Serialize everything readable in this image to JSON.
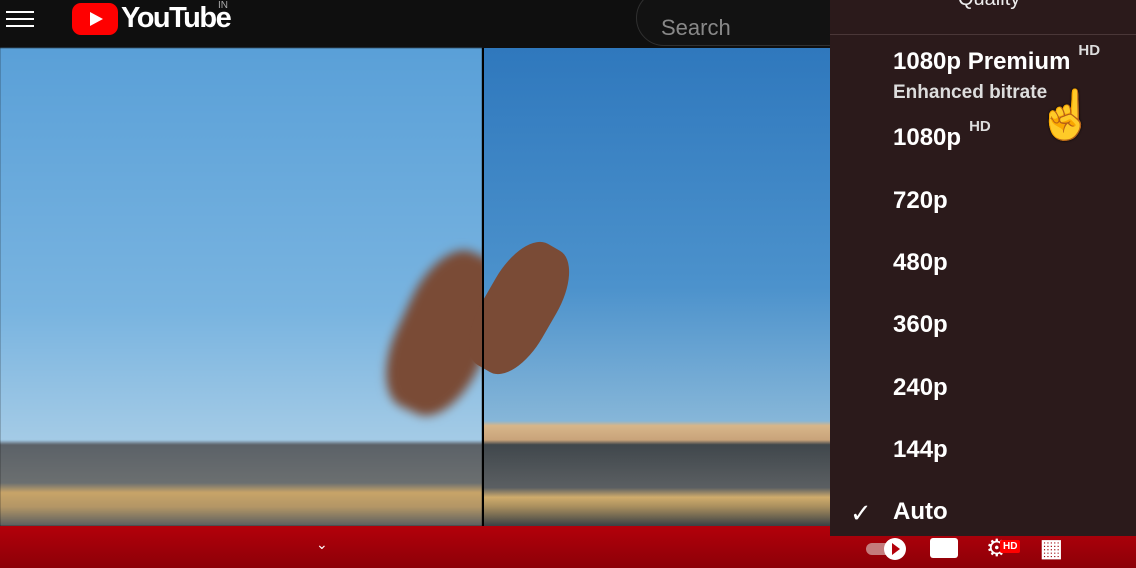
{
  "header": {
    "logo_text": "YouTube",
    "country_code": "IN",
    "search_placeholder": "Search"
  },
  "quality_menu": {
    "title": "Quality",
    "items": [
      {
        "label": "1080p Premium",
        "badge": "HD",
        "sublabel": "Enhanced bitrate"
      },
      {
        "label": "1080p",
        "badge": "HD"
      },
      {
        "label": "720p"
      },
      {
        "label": "480p"
      },
      {
        "label": "360p"
      },
      {
        "label": "240p"
      },
      {
        "label": "144p"
      },
      {
        "label": "Auto",
        "selected": true
      }
    ]
  },
  "controls": {
    "autoplay": "on",
    "settings_badge": "HD"
  },
  "colors": {
    "accent": "#ff0000",
    "panel": "#2b1a1b",
    "bar": "#b3000a"
  }
}
